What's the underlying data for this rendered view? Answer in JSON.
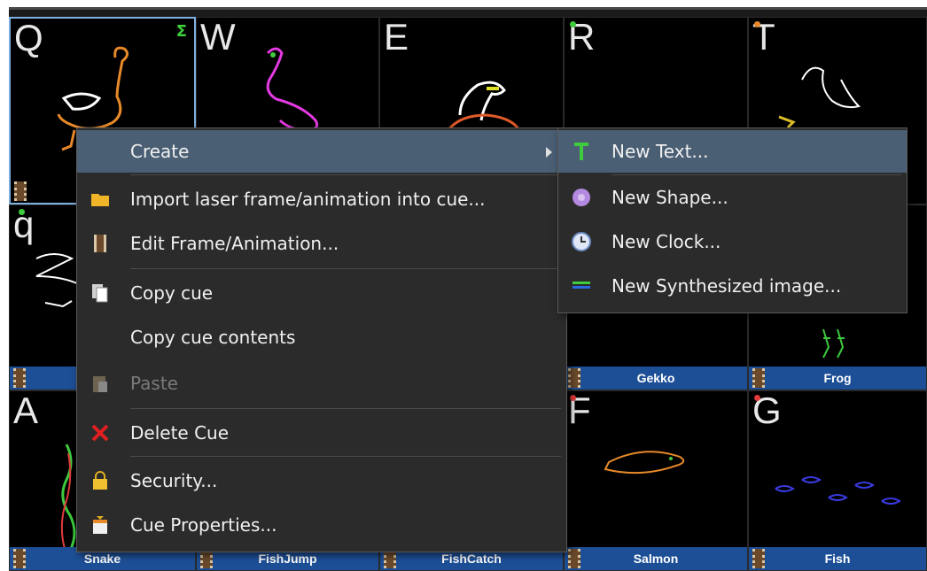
{
  "cells": [
    {
      "key": "Q",
      "label": "",
      "dot": "#3ecb3e",
      "sigma": "Σ"
    },
    {
      "key": "W",
      "label": "",
      "dot": "#3ecb3e"
    },
    {
      "key": "E",
      "label": "",
      "dot": "#3ecb3e"
    },
    {
      "key": "R",
      "label": "",
      "dot": "#3ecb3e"
    },
    {
      "key": "T",
      "label": "",
      "dot": "#e88a2a"
    },
    {
      "key": "q",
      "label": "",
      "dot": "#3ecb3e"
    },
    {
      "key": "",
      "label": ""
    },
    {
      "key": "",
      "label": ""
    },
    {
      "key": "",
      "label": "Gekko"
    },
    {
      "key": "",
      "label": "Frog"
    },
    {
      "key": "A",
      "label": "Snake"
    },
    {
      "key": "",
      "label": "FishJump"
    },
    {
      "key": "",
      "label": "FishCatch"
    },
    {
      "key": "F",
      "label": "Salmon",
      "dot": "#e23a3a"
    },
    {
      "key": "G",
      "label": "Fish",
      "dot": "#e23a3a"
    }
  ],
  "menu": {
    "items": [
      {
        "label": "Create",
        "icon": "none"
      },
      {
        "label": "Import laser frame/animation into cue...",
        "icon": "folder-icon"
      },
      {
        "label": "Edit Frame/Animation...",
        "icon": "film-icon"
      },
      {
        "label": "Copy cue",
        "icon": "copy-icon"
      },
      {
        "label": "Copy cue contents",
        "icon": "none"
      },
      {
        "label": "Paste",
        "icon": "paste-icon"
      },
      {
        "label": "Delete Cue",
        "icon": "delete-icon"
      },
      {
        "label": "Security...",
        "icon": "lock-icon"
      },
      {
        "label": "Cue Properties...",
        "icon": "properties-icon"
      }
    ]
  },
  "submenu": {
    "items": [
      {
        "label": "New Text...",
        "icon": "text-icon"
      },
      {
        "label": "New Shape...",
        "icon": "shape-icon"
      },
      {
        "label": "New Clock...",
        "icon": "clock-icon"
      },
      {
        "label": "New Synthesized image...",
        "icon": "synth-icon"
      }
    ]
  },
  "colors": {
    "menu_bg": "#2b2b2b",
    "highlight": "#4b5f74",
    "label_bar": "#1d4f96"
  }
}
